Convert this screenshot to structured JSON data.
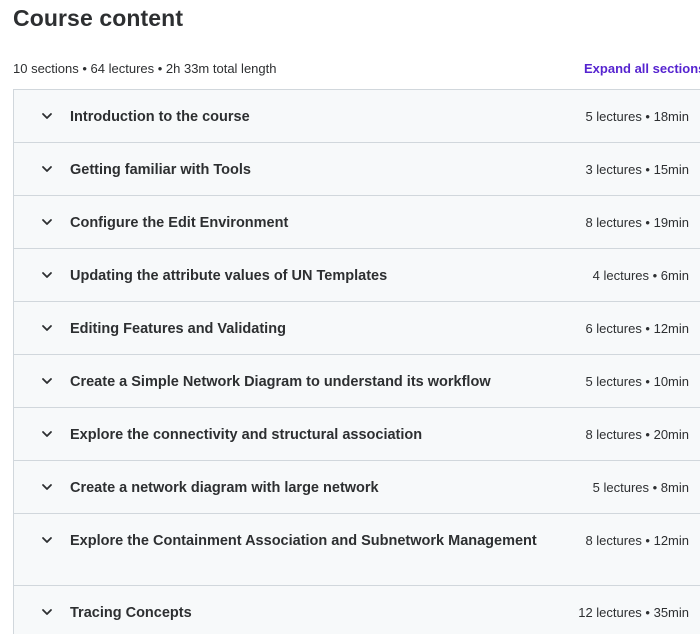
{
  "header": {
    "title": "Course content",
    "summary": "10 sections • 64 lectures • 2h 33m total length",
    "expand_label": "Expand all sections"
  },
  "sections": [
    {
      "title": "Introduction to the course",
      "meta": "5 lectures • 18min"
    },
    {
      "title": "Getting familiar with Tools",
      "meta": "3 lectures • 15min"
    },
    {
      "title": "Configure the Edit Environment",
      "meta": "8 lectures • 19min"
    },
    {
      "title": "Updating the attribute values of UN Templates",
      "meta": "4 lectures • 6min"
    },
    {
      "title": "Editing Features and Validating",
      "meta": "6 lectures • 12min"
    },
    {
      "title": "Create a Simple Network Diagram to understand its workflow",
      "meta": "5 lectures • 10min"
    },
    {
      "title": "Explore the connectivity and structural association",
      "meta": "8 lectures • 20min"
    },
    {
      "title": "Create a network diagram with large network",
      "meta": "5 lectures • 8min"
    },
    {
      "title": "Explore the Containment Association and Subnetwork Management",
      "meta": "8 lectures • 12min"
    },
    {
      "title": "Tracing Concepts",
      "meta": "12 lectures • 35min"
    }
  ],
  "colors": {
    "text": "#2d2f31",
    "accent": "#5624d0",
    "section_bg": "#f7f9fa",
    "border": "#d1d7dc"
  },
  "icons": {
    "section_toggle": "chevron-down-icon"
  }
}
